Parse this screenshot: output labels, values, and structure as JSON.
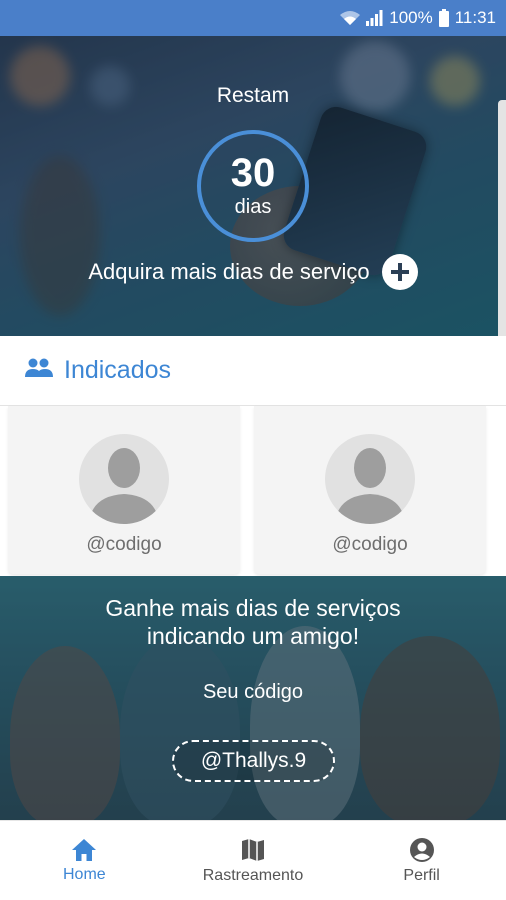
{
  "status_bar": {
    "battery": "100%",
    "time": "11:31"
  },
  "hero": {
    "title": "Restam",
    "days_number": "30",
    "days_unit": "dias",
    "buy_label": "Adquira mais dias de serviço"
  },
  "indicados": {
    "title": "Indicados",
    "cards": [
      {
        "code": "@codigo"
      },
      {
        "code": "@codigo"
      }
    ]
  },
  "referral": {
    "headline_line1": "Ganhe mais dias de serviços",
    "headline_line2": "indicando um amigo!",
    "code_label": "Seu código",
    "code_value": "@Thallys.9"
  },
  "bottom_nav": {
    "items": [
      {
        "label": "Home",
        "icon": "home-icon",
        "active": true
      },
      {
        "label": "Rastreamento",
        "icon": "map-icon",
        "active": false
      },
      {
        "label": "Perfil",
        "icon": "account-circle-icon",
        "active": false
      }
    ]
  },
  "colors": {
    "accent": "#3d86d4",
    "status_bar": "#4a7fc9",
    "ring": "#4a8fd8"
  }
}
